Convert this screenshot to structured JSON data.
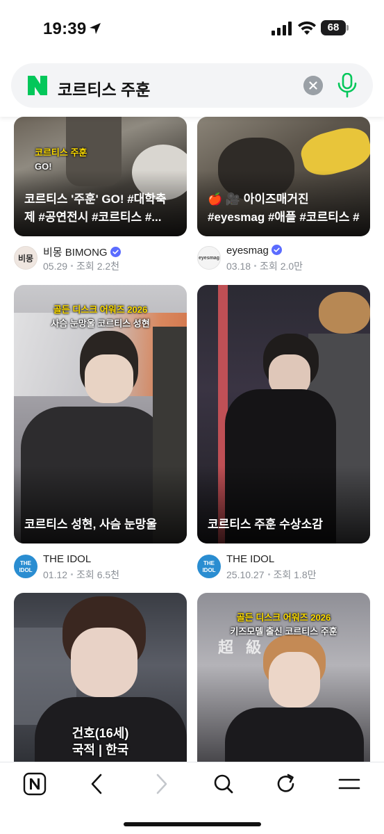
{
  "status_bar": {
    "time": "19:39",
    "battery": "68"
  },
  "search": {
    "query": "코르티스 주훈"
  },
  "cards": [
    {
      "title": "코르티스 '주훈' GO! #대학축제 #공연전시 #코르티스 #...",
      "caption_lines": [
        "코르티스 주훈",
        "GO!"
      ],
      "channel": "비몽 BIMONG",
      "avatar_text": "비몽",
      "verified": true,
      "date": "05.29",
      "views": "조회 2.2천"
    },
    {
      "title": "🍎 🎥 아이즈매거진 #eyesmag #애플 #코르티스 #제...",
      "caption_lines": [],
      "channel": "eyesmag",
      "avatar_text": "eyesmag",
      "verified": true,
      "date": "03.18",
      "views": "조회 2.0만"
    },
    {
      "title": "코르티스 성현, 사슴 눈망울",
      "caption_lines": [
        "골든 디스크 어워즈 2026",
        "사슴 눈망울 코르티스 성현"
      ],
      "channel": "THE IDOL",
      "avatar_text": "THE IDOL",
      "verified": false,
      "date": "01.12",
      "views": "조회 6.5천"
    },
    {
      "title": "코르티스 주훈 수상소감",
      "caption_lines": [],
      "channel": "THE IDOL",
      "avatar_text": "THE IDOL",
      "verified": false,
      "date": "25.10.27",
      "views": "조회 1.8만"
    },
    {
      "title": "",
      "caption_lines": [
        "건호(16세)",
        "국적 | 한국"
      ],
      "channel": "",
      "avatar_text": "",
      "verified": false,
      "date": "",
      "views": ""
    },
    {
      "title": "",
      "caption_lines": [
        "골든 디스크 어워즈 2026",
        "키즈모델 출신 코르티스 주훈",
        "超 級"
      ],
      "channel": "",
      "avatar_text": "",
      "verified": false,
      "date": "",
      "views": ""
    }
  ],
  "icons": {
    "location": "location-arrow-icon",
    "signal": "cellular-signal-icon",
    "wifi": "wifi-icon",
    "clear": "clear-icon",
    "mic": "microphone-icon",
    "verified": "verified-badge-icon",
    "home": "naver-home-icon",
    "back": "back-arrow-icon",
    "forward": "forward-arrow-icon",
    "search": "search-icon",
    "refresh": "refresh-icon",
    "menu": "menu-icon"
  },
  "colors": {
    "naver_green": "#03c75a",
    "verified_blue": "#5b6cff",
    "caption_yellow": "#ffdd00",
    "disabled": "#c4c7cc"
  }
}
